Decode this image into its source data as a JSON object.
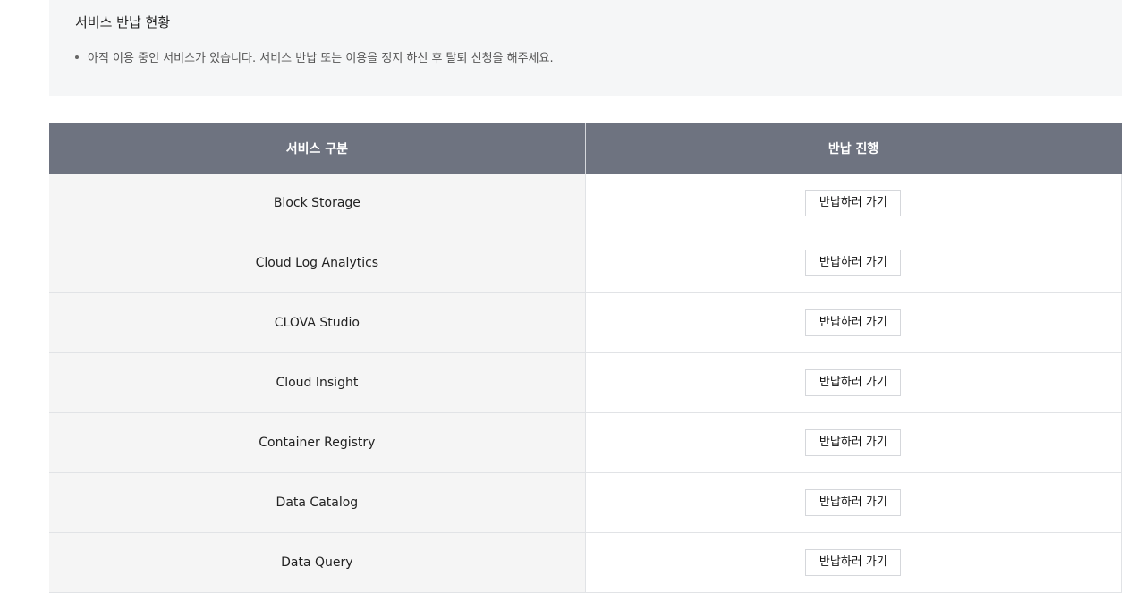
{
  "notice": {
    "title": "서비스 반납 현황",
    "message": "아직 이용 중인 서비스가 있습니다. 서비스 반납 또는 이용을 정지 하신 후 탈퇴 신청을 해주세요."
  },
  "table": {
    "columns": [
      "서비스 구분",
      "반납 진행"
    ],
    "button_label": "반납하러 가기",
    "rows": [
      "Block Storage",
      "Cloud Log Analytics",
      "CLOVA Studio",
      "Cloud Insight",
      "Container Registry",
      "Data Catalog",
      "Data Query"
    ]
  },
  "colors": {
    "header_bg": "#6e7380",
    "notice_bg": "#f5f6f7",
    "name_cell_bg": "#f5f5f5"
  }
}
